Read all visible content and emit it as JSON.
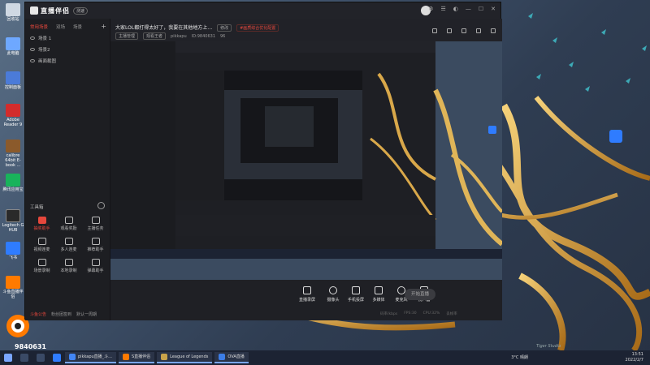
{
  "desktop": {
    "icons": [
      {
        "label": "回收站",
        "color": "#cfd8e3"
      },
      {
        "label": "此电脑",
        "color": "#6ea8ff"
      },
      {
        "label": "控制面板",
        "color": "#4b7bd8"
      },
      {
        "label": "Adobe Reader 9",
        "color": "#d32c2c"
      },
      {
        "label": "calibre 64bit E-book ...",
        "color": "#8b5a2b"
      },
      {
        "label": "腾讯应用宝",
        "color": "#19b35b"
      },
      {
        "label": "Logitech G HUB",
        "color": "#2a2a2a"
      },
      {
        "label": "飞书",
        "color": "#2f7cff"
      },
      {
        "label": "斗鱼直播伴侣",
        "color": "#ff7a00"
      }
    ],
    "douyu_id": "9840631",
    "watermark": "Tiger Studio"
  },
  "app": {
    "title": "直播伴侣",
    "version_badge": "测速",
    "left_tabs": [
      "常用场景",
      "双场",
      "场景"
    ],
    "scenes": [
      "场景 1",
      "场景2",
      "画面截图"
    ],
    "tools_header": "工具箱",
    "tools": [
      {
        "label": "抽奖助手",
        "highlight": true
      },
      {
        "label": "观看奖励",
        "highlight": false
      },
      {
        "label": "主播任务",
        "highlight": false
      },
      {
        "label": "视频连麦",
        "highlight": false
      },
      {
        "label": "多人连麦",
        "highlight": false
      },
      {
        "label": "推荐助手",
        "highlight": false
      },
      {
        "label": "场景录制",
        "highlight": false
      },
      {
        "label": "本地录制",
        "highlight": false
      },
      {
        "label": "弹幕助手",
        "highlight": false
      }
    ],
    "status": [
      "斗鱼公告",
      "粉丝团签到",
      "默认一周期"
    ],
    "stream_title": "大家LOL都打得太好了，我要在其他地方上…",
    "stream_title_chips": [
      "修改",
      "#画质综合优化配置"
    ],
    "sub_info": [
      "主播管理",
      "观看王者",
      "pikkapu",
      "ID:9840631",
      "96"
    ],
    "bottom_buttons": [
      "直播录屏",
      "摄像头",
      "手机投屏",
      "多媒体",
      "麦克风",
      "扬声器"
    ],
    "go_live": "开始直播",
    "metrics": [
      "码率/kbps",
      "FPS:30",
      "CPU:32%",
      "丢帧率"
    ],
    "taskbar_apps": [
      {
        "label": "pikkapu直播_斗...",
        "color": "#4285f4"
      },
      {
        "label": "S直播伴侣",
        "color": "#ff7a00"
      },
      {
        "label": "League of Legends",
        "color": "#c8a24a"
      },
      {
        "label": "OVA直播",
        "color": "#3c7de6"
      }
    ],
    "tray_temp": "3°C 晴朗",
    "time": "13:51",
    "date": "2022/2/7"
  }
}
